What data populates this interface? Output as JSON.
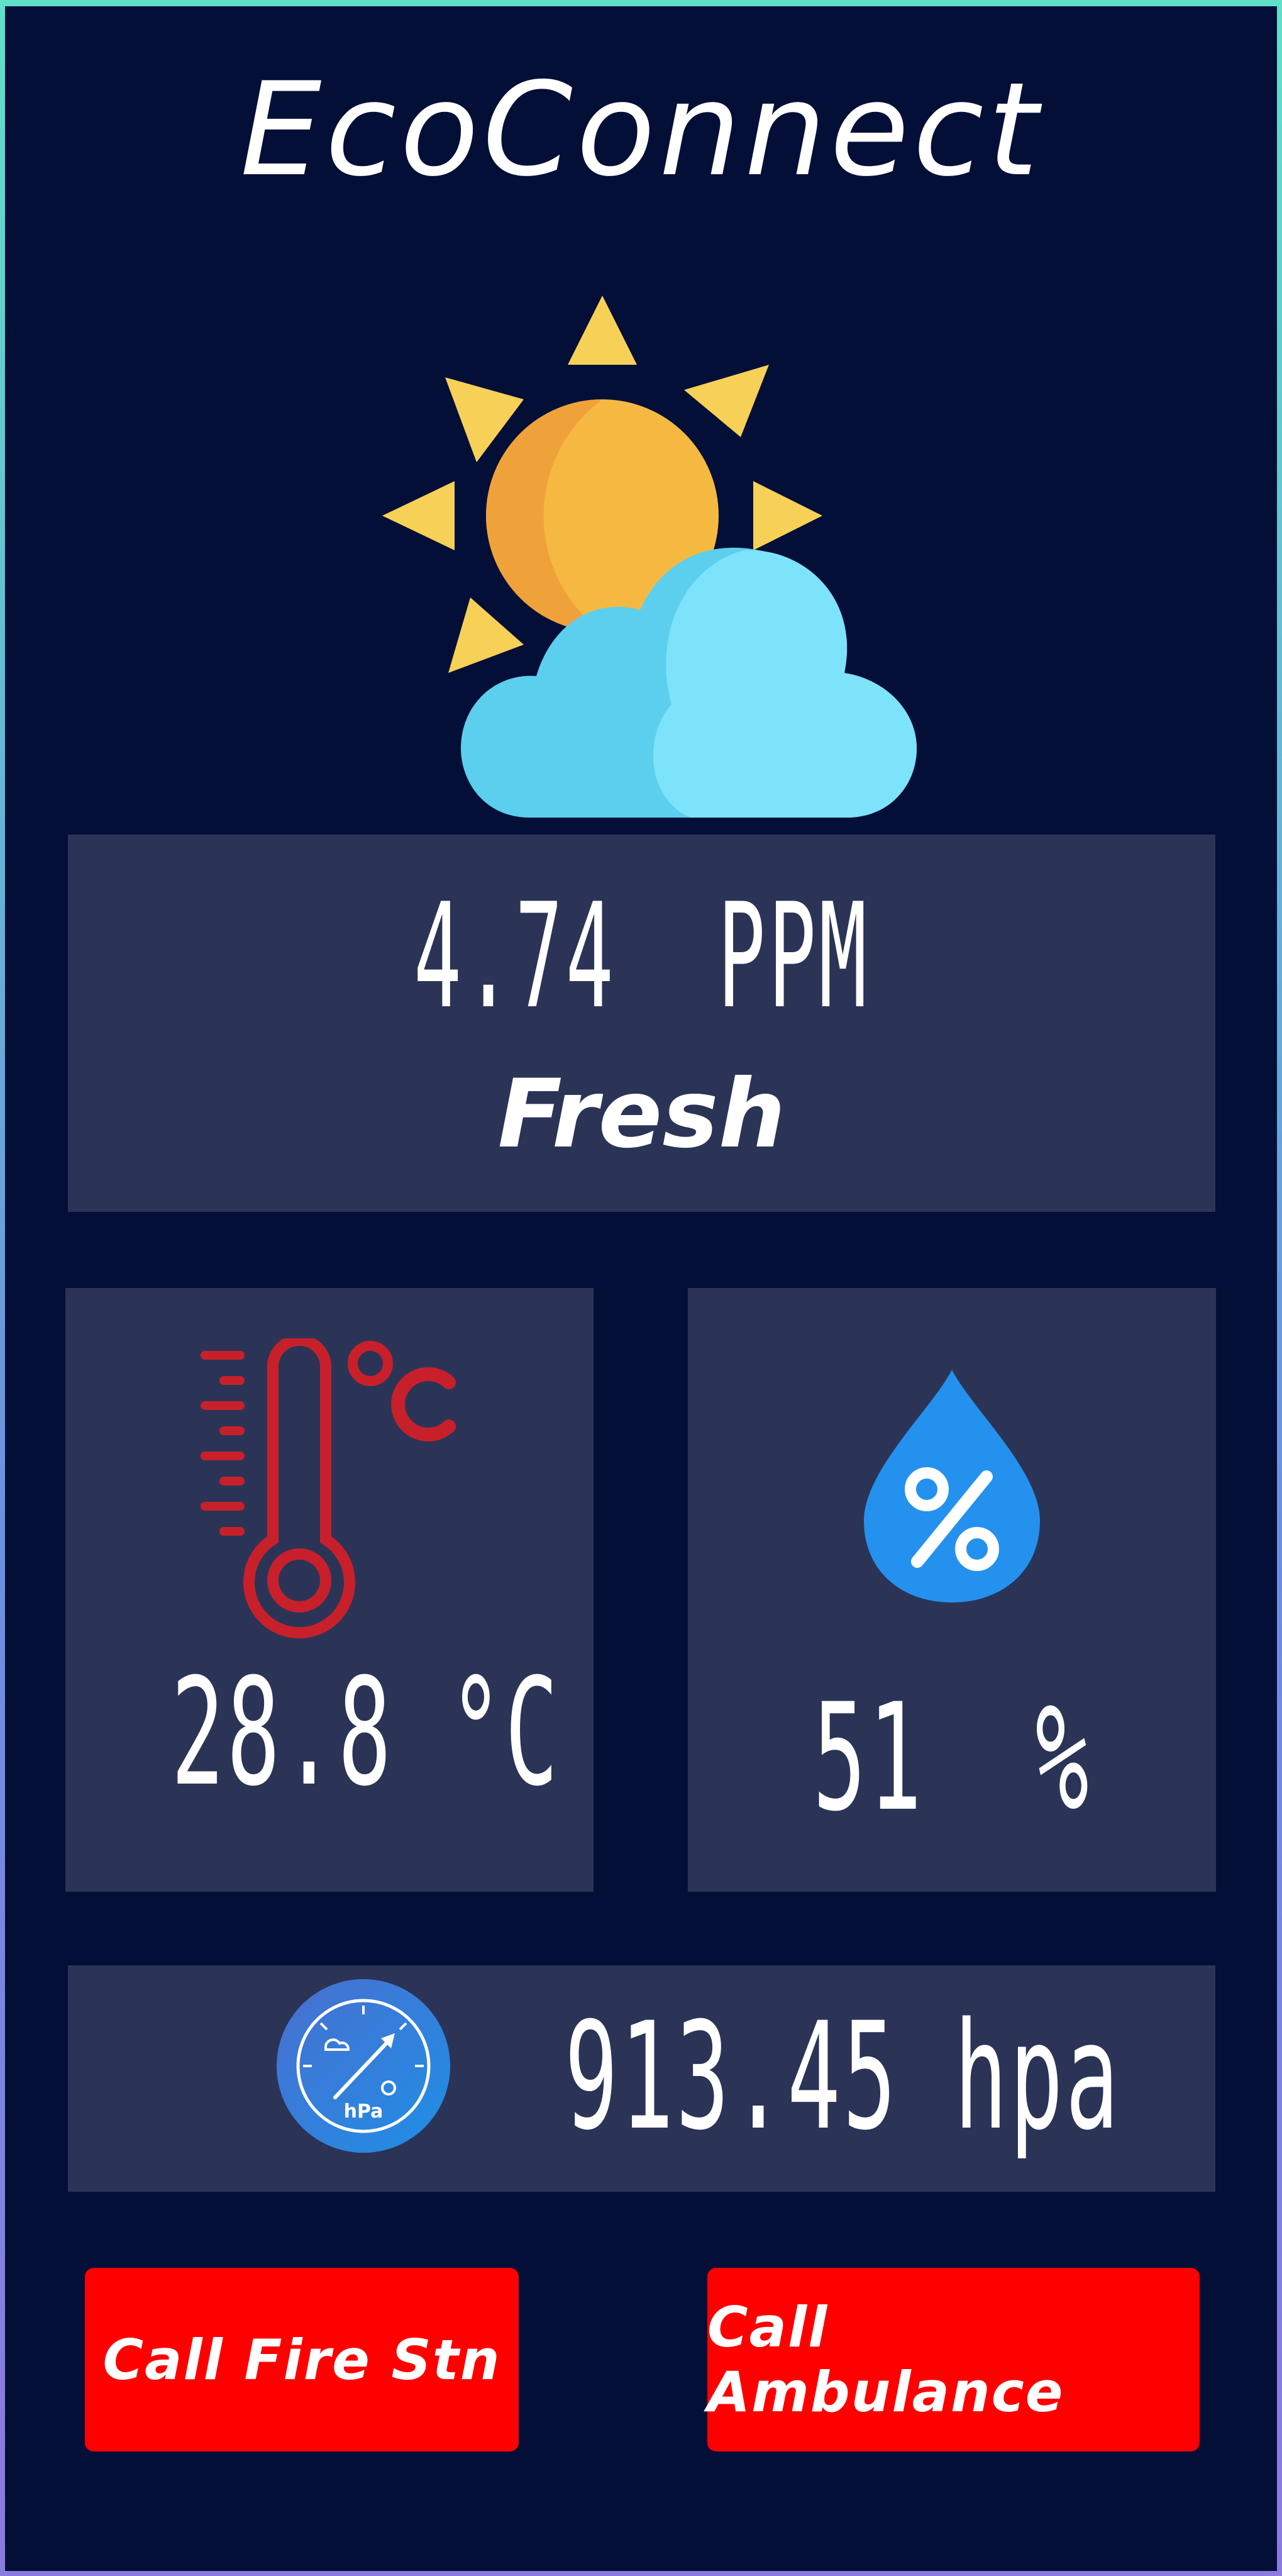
{
  "app": {
    "title": "EcoConnect"
  },
  "weather": {
    "icon": "partly-cloudy-icon"
  },
  "air_quality": {
    "value": "4.74  PPM",
    "status": "Fresh"
  },
  "temperature": {
    "icon": "thermometer-celsius-icon",
    "value": "28.8 °C"
  },
  "humidity": {
    "icon": "humidity-drop-icon",
    "value": "51  %"
  },
  "pressure": {
    "icon": "barometer-gauge-icon",
    "icon_label": "hPa",
    "value": "913.45 hpa"
  },
  "actions": {
    "fire_label": "Call Fire Stn",
    "ambulance_label": "Call Ambulance"
  },
  "colors": {
    "background": "#040f38",
    "card": "#2b3457",
    "button": "#ff0000",
    "sun": "#f5b942",
    "cloud": "#5ccfee",
    "thermometer": "#c8202a",
    "drop": "#2491ee"
  }
}
